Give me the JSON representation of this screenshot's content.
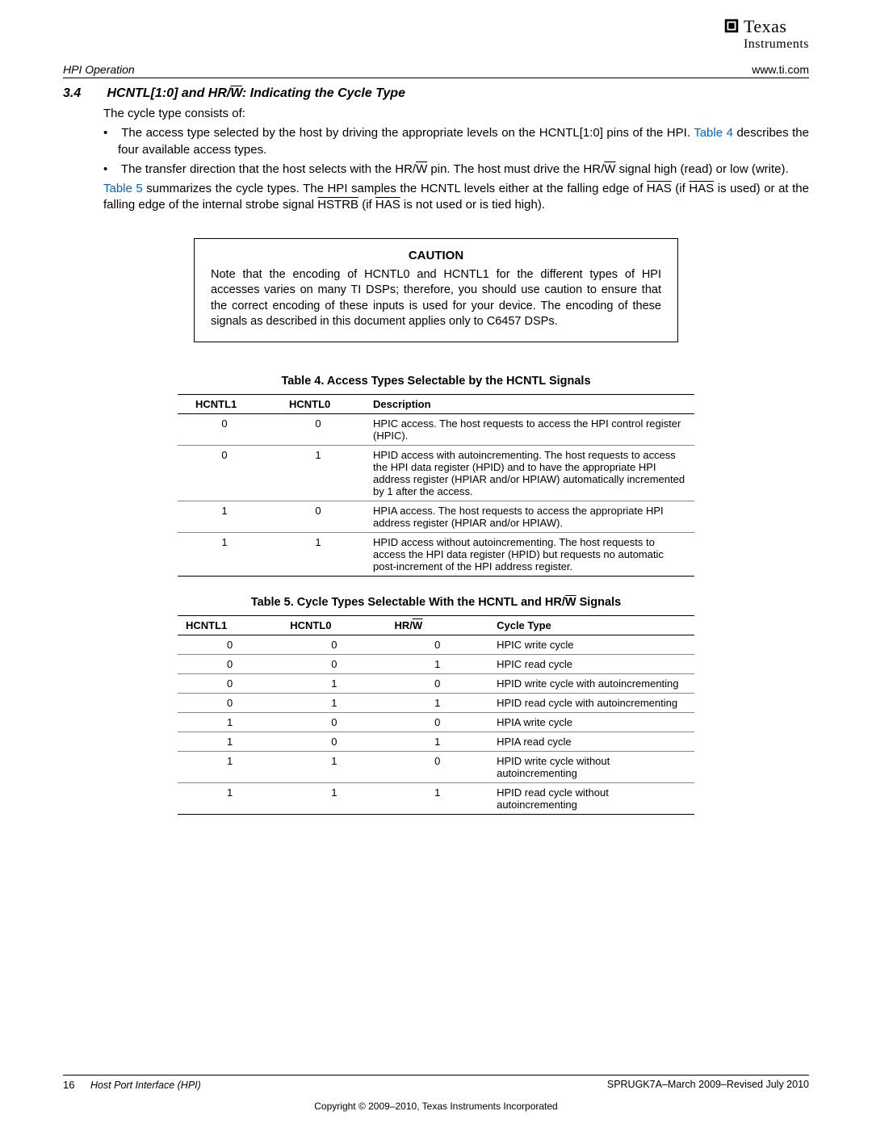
{
  "header": {
    "section_title": "HPI Operation",
    "url": "www.ti.com",
    "logo_top": "Texas",
    "logo_bottom": "Instruments"
  },
  "section": {
    "number": "3.4",
    "title_prefix": "HCNTL[1:0] and HR/",
    "title_w": "W",
    "title_suffix": ": Indicating the Cycle Type"
  },
  "intro": "The cycle type consists of:",
  "bullet1": {
    "a": "The access type selected by the host by driving the appropriate levels on the HCNTL[1:0] pins of the HPI. ",
    "link": "Table 4",
    "b": " describes the four available access types."
  },
  "bullet2": {
    "a": "The transfer direction that the host selects with the HR/",
    "w1": "W",
    "b": " pin. The host must drive the HR/",
    "w2": "W",
    "c": " signal high (read) or low (write)."
  },
  "para2": {
    "link": "Table 5",
    "a": " summarizes the cycle types. The HPI samples the HCNTL levels either at the falling edge of ",
    "has1": "HAS",
    "b": " (if ",
    "has2": "HAS",
    "c": " is used) or at the falling edge of the internal strobe signal ",
    "hstrb": "HSTRB",
    "d": " (if ",
    "has3": "HAS",
    "e": " is not used or is tied high)."
  },
  "caution": {
    "title": "CAUTION",
    "text": "Note that the encoding of HCNTL0 and HCNTL1 for the different types of HPI accesses varies on many TI DSPs; therefore, you should use caution to ensure that the correct encoding of these inputs is used for your device. The encoding of these signals as described in this document applies only to C6457 DSPs."
  },
  "table4": {
    "title": "Table 4. Access Types Selectable by the HCNTL Signals",
    "headers": [
      "HCNTL1",
      "HCNTL0",
      "Description"
    ],
    "rows": [
      {
        "c1": "0",
        "c2": "0",
        "desc": "HPIC access. The host requests to access the HPI control register (HPIC)."
      },
      {
        "c1": "0",
        "c2": "1",
        "desc": "HPID access with autoincrementing. The host requests to access the HPI data register (HPID) and to have the appropriate HPI address register (HPIAR and/or HPIAW) automatically incremented by 1 after the access."
      },
      {
        "c1": "1",
        "c2": "0",
        "desc": "HPIA access. The host requests to access the appropriate HPI address register (HPIAR and/or HPIAW)."
      },
      {
        "c1": "1",
        "c2": "1",
        "desc": "HPID access without autoincrementing. The host requests to access the HPI data register (HPID) but requests no automatic post-increment of the HPI address register."
      }
    ]
  },
  "table5": {
    "title_a": "Table 5. Cycle Types Selectable With the HCNTL and HR/",
    "title_w": "W",
    "title_b": " Signals",
    "h1": "HCNTL1",
    "h2": "HCNTL0",
    "h3a": "HR/",
    "h3w": "W",
    "h4": "Cycle Type",
    "rows": [
      {
        "c1": "0",
        "c2": "0",
        "c3": "0",
        "ct": "HPIC write cycle"
      },
      {
        "c1": "0",
        "c2": "0",
        "c3": "1",
        "ct": "HPIC read cycle"
      },
      {
        "c1": "0",
        "c2": "1",
        "c3": "0",
        "ct": "HPID write cycle with autoincrementing"
      },
      {
        "c1": "0",
        "c2": "1",
        "c3": "1",
        "ct": "HPID read cycle with autoincrementing"
      },
      {
        "c1": "1",
        "c2": "0",
        "c3": "0",
        "ct": "HPIA write cycle"
      },
      {
        "c1": "1",
        "c2": "0",
        "c3": "1",
        "ct": "HPIA read cycle"
      },
      {
        "c1": "1",
        "c2": "1",
        "c3": "0",
        "ct": "HPID write cycle without autoincrementing"
      },
      {
        "c1": "1",
        "c2": "1",
        "c3": "1",
        "ct": "HPID read cycle without autoincrementing"
      }
    ]
  },
  "footer": {
    "page": "16",
    "doc_title": "Host Port Interface (HPI)",
    "right": "SPRUGK7A–March 2009–Revised July 2010",
    "copyright": "Copyright © 2009–2010, Texas Instruments Incorporated"
  }
}
